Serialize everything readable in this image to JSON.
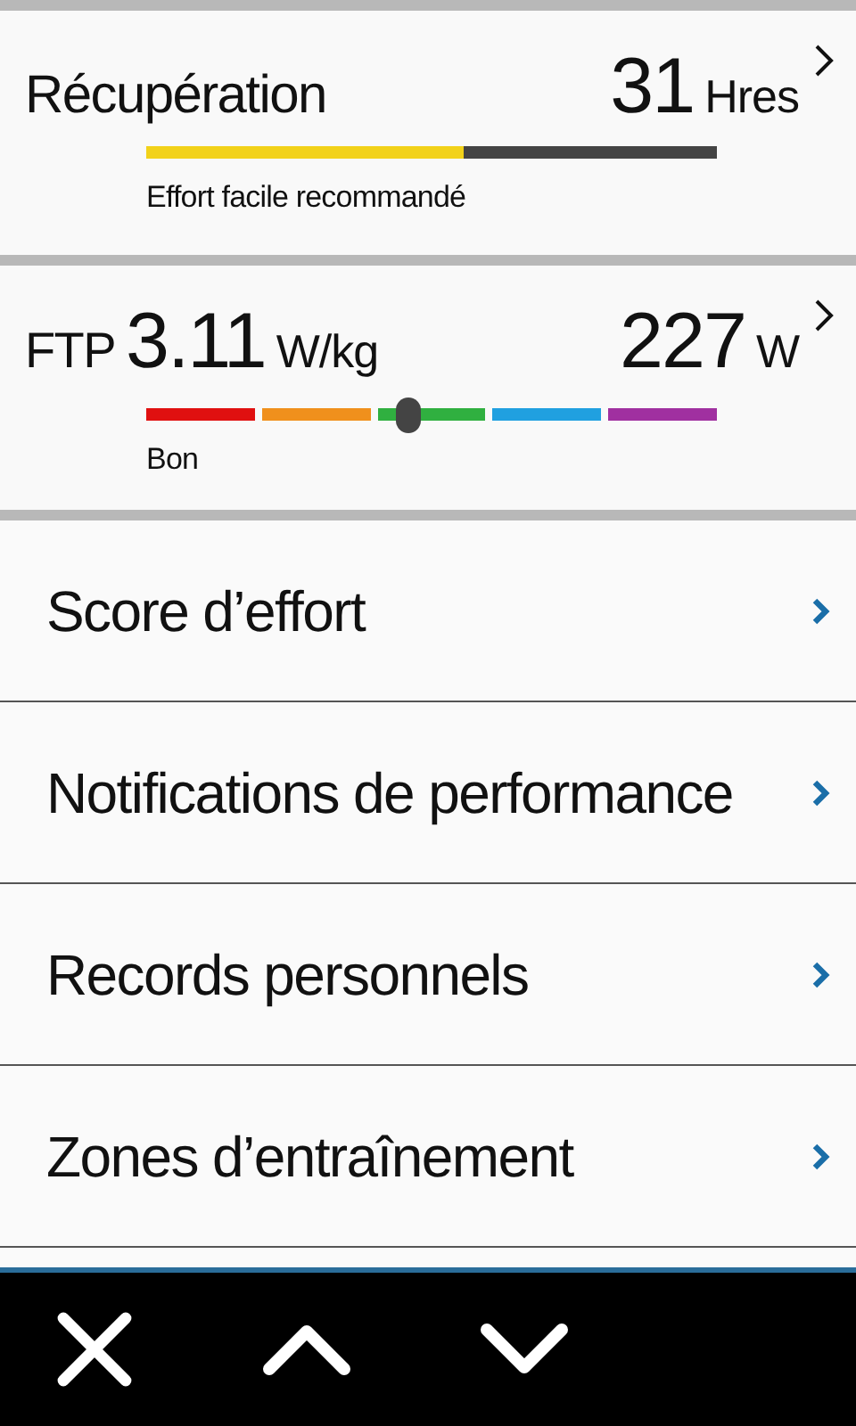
{
  "recovery": {
    "title": "Récupération",
    "value": "31",
    "unit": "Hres",
    "level": 0.556,
    "message": "Effort facile recommandé"
  },
  "ftp": {
    "title": "FTP",
    "ratio": "3.11",
    "ratio_unit": "W/kg",
    "power": "227",
    "power_unit": "W",
    "level": 0.46,
    "zones": [
      {
        "color": "#e01010"
      },
      {
        "color": "#f0901c"
      },
      {
        "color": "#30b040"
      },
      {
        "color": "#20a0e0"
      },
      {
        "color": "#a030a0"
      }
    ],
    "rating": "Bon"
  },
  "menu": [
    {
      "label": "Score d’effort"
    },
    {
      "label": "Notifications de performance"
    },
    {
      "label": "Records personnels"
    },
    {
      "label": "Zones d’entraînement"
    }
  ],
  "toolbar": [
    {
      "kind": "close"
    },
    {
      "kind": "up"
    },
    {
      "kind": "down"
    }
  ]
}
